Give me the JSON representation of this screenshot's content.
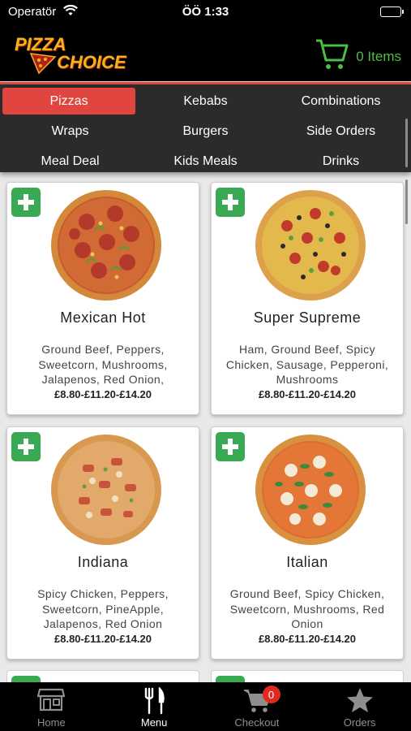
{
  "status_bar": {
    "carrier": "Operatör",
    "time": "ÖÖ 1:33"
  },
  "header": {
    "logo_line1": "PIZZA",
    "logo_line2": "CHOICE",
    "cart_count": "0 Items"
  },
  "categories": [
    {
      "label": "Pizzas",
      "active": true
    },
    {
      "label": "Kebabs"
    },
    {
      "label": "Combinations"
    },
    {
      "label": "Wraps"
    },
    {
      "label": "Burgers"
    },
    {
      "label": "Side Orders"
    },
    {
      "label": "Meal Deal"
    },
    {
      "label": "Kids Meals"
    },
    {
      "label": "Drinks"
    }
  ],
  "products": [
    {
      "name": "Mexican Hot",
      "desc": "Ground Beef, Peppers, Sweetcorn, Mushrooms, Jalapenos, Red Onion,",
      "price": "£8.80-£11.20-£14.20"
    },
    {
      "name": "Super Supreme",
      "desc": "Ham, Ground Beef, Spicy Chicken, Sausage, Pepperoni, Mushrooms",
      "price": "£8.80-£11.20-£14.20"
    },
    {
      "name": "Indiana",
      "desc": "Spicy Chicken, Peppers, Sweetcorn, PineApple, Jalapenos, Red Onion",
      "price": "£8.80-£11.20-£14.20"
    },
    {
      "name": "Italian",
      "desc": "Ground Beef, Spicy Chicken, Sweetcorn, Mushrooms, Red Onion",
      "price": "£8.80-£11.20-£14.20"
    }
  ],
  "tabs": [
    {
      "label": "Home",
      "icon": "store-icon"
    },
    {
      "label": "Menu",
      "icon": "fork-knife-icon",
      "active": true
    },
    {
      "label": "Checkout",
      "icon": "cart-icon",
      "badge": "0"
    },
    {
      "label": "Orders",
      "icon": "star-icon"
    }
  ],
  "colors": {
    "accent_red": "#e0463f",
    "add_green": "#39a954",
    "cart_green": "#4dbd45",
    "logo_yellow": "#f2b416"
  }
}
